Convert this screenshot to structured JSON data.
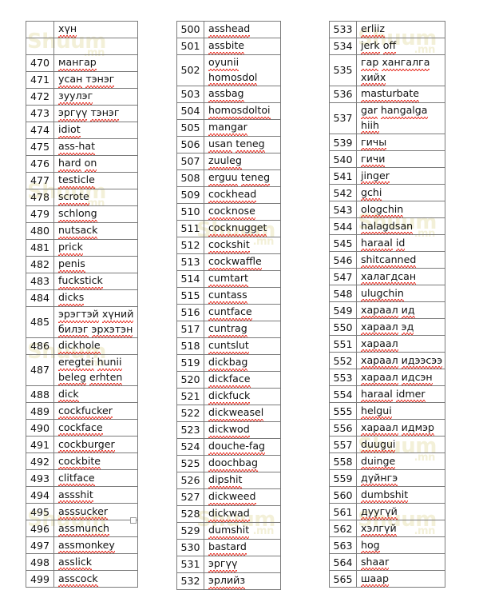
{
  "document": {
    "type": "word-list-table",
    "watermark": {
      "main": "Shuum",
      "sub": ".mn"
    },
    "columns": [
      {
        "id": "column-1",
        "header": {
          "num": "",
          "text": "хүн"
        },
        "rows": [
          {
            "num": "470",
            "text": "мангар"
          },
          {
            "num": "471",
            "text": "усан тэнэг"
          },
          {
            "num": "472",
            "text": "зуулэг"
          },
          {
            "num": "473",
            "text": "эргүү тэнэг"
          },
          {
            "num": "474",
            "text": "idiot"
          },
          {
            "num": "475",
            "text": "ass-hat"
          },
          {
            "num": "476",
            "text": "hard on"
          },
          {
            "num": "477",
            "text": "testicle"
          },
          {
            "num": "478",
            "text": "scrote"
          },
          {
            "num": "479",
            "text": "schlong"
          },
          {
            "num": "480",
            "text": "nutsack"
          },
          {
            "num": "481",
            "text": "prick"
          },
          {
            "num": "482",
            "text": "penis"
          },
          {
            "num": "483",
            "text": "fuckstick"
          },
          {
            "num": "484",
            "text": "dicks"
          },
          {
            "num": "485",
            "text": "эрэгтэй хүний билэг эрхэтэн",
            "lines": [
              "эрэгтэй хүний",
              "билэг эрхэтэн"
            ]
          },
          {
            "num": "486",
            "text": "dickhole"
          },
          {
            "num": "487",
            "text": "eregtei hunii beleg erhten",
            "lines": [
              "eregtei hunii",
              "beleg erhten"
            ]
          },
          {
            "num": "488",
            "text": "dick"
          },
          {
            "num": "489",
            "text": "cockfucker"
          },
          {
            "num": "490",
            "text": "cockface"
          },
          {
            "num": "491",
            "text": "cockburger"
          },
          {
            "num": "492",
            "text": "cockbite"
          },
          {
            "num": "493",
            "text": "clitface"
          },
          {
            "num": "494",
            "text": "assshit"
          },
          {
            "num": "495",
            "text": "asssucker"
          },
          {
            "num": "496",
            "text": "assmunch"
          },
          {
            "num": "497",
            "text": "assmonkey"
          },
          {
            "num": "498",
            "text": "asslick"
          },
          {
            "num": "499",
            "text": "asscock"
          }
        ]
      },
      {
        "id": "column-2",
        "header": null,
        "rows": [
          {
            "num": "500",
            "text": "asshead"
          },
          {
            "num": "501",
            "text": "assbite"
          },
          {
            "num": "502",
            "text": "oyunii homosdol",
            "lines": [
              "oyunii",
              "homosdol"
            ]
          },
          {
            "num": "503",
            "text": "assbag"
          },
          {
            "num": "504",
            "text": "homosdoltoi"
          },
          {
            "num": "505",
            "text": "mangar"
          },
          {
            "num": "506",
            "text": "usan teneg"
          },
          {
            "num": "507",
            "text": "zuuleg"
          },
          {
            "num": "508",
            "text": "erguu teneg"
          },
          {
            "num": "509",
            "text": "cockhead"
          },
          {
            "num": "510",
            "text": "cocknose"
          },
          {
            "num": "511",
            "text": "cocknugget"
          },
          {
            "num": "512",
            "text": "cockshit"
          },
          {
            "num": "513",
            "text": "cockwaffle"
          },
          {
            "num": "514",
            "text": "cumtart"
          },
          {
            "num": "515",
            "text": "cuntass"
          },
          {
            "num": "516",
            "text": "cuntface"
          },
          {
            "num": "517",
            "text": "cuntrag"
          },
          {
            "num": "518",
            "text": "cuntslut"
          },
          {
            "num": "519",
            "text": "dickbag"
          },
          {
            "num": "520",
            "text": "dickface"
          },
          {
            "num": "521",
            "text": "dickfuck"
          },
          {
            "num": "522",
            "text": "dickweasel"
          },
          {
            "num": "523",
            "text": "dickwod"
          },
          {
            "num": "524",
            "text": "douche-fag"
          },
          {
            "num": "525",
            "text": "doochbag"
          },
          {
            "num": "526",
            "text": "dipshit"
          },
          {
            "num": "527",
            "text": "dickweed"
          },
          {
            "num": "528",
            "text": "dickwad"
          },
          {
            "num": "529",
            "text": "dumshit"
          },
          {
            "num": "530",
            "text": "bastard"
          },
          {
            "num": "531",
            "text": "эргүү"
          },
          {
            "num": "532",
            "text": "эрлийз"
          }
        ]
      },
      {
        "id": "column-3",
        "header": null,
        "rows": [
          {
            "num": "533",
            "text": "erliiz"
          },
          {
            "num": "534",
            "text": "jerk off"
          },
          {
            "num": "535",
            "text": "гар хангалга хийх",
            "lines": [
              "гар хангалга",
              "хийх"
            ]
          },
          {
            "num": "536",
            "text": "masturbate"
          },
          {
            "num": "537",
            "text": "gar hangalga hiih",
            "lines": [
              "gar hangalga",
              "hiih"
            ]
          },
          {
            "num": "539",
            "text": "гичы"
          },
          {
            "num": "540",
            "text": "гичи"
          },
          {
            "num": "541",
            "text": "jinger"
          },
          {
            "num": "542",
            "text": "gchi"
          },
          {
            "num": "543",
            "text": "ologchin"
          },
          {
            "num": "544",
            "text": "halagdsan"
          },
          {
            "num": "545",
            "text": "haraal id"
          },
          {
            "num": "546",
            "text": "shitcanned"
          },
          {
            "num": "547",
            "text": "халагдсан"
          },
          {
            "num": "548",
            "text": "ulugchin"
          },
          {
            "num": "549",
            "text": "хараал ид"
          },
          {
            "num": "550",
            "text": "хараал эд"
          },
          {
            "num": "551",
            "text": "хараал"
          },
          {
            "num": "552",
            "text": "хараал идээсээ"
          },
          {
            "num": "553",
            "text": "хараал идсэн"
          },
          {
            "num": "554",
            "text": "haraal idmer"
          },
          {
            "num": "555",
            "text": "helgui"
          },
          {
            "num": "556",
            "text": "хараал идмэр"
          },
          {
            "num": "557",
            "text": "duugui"
          },
          {
            "num": "558",
            "text": "duinge"
          },
          {
            "num": "559",
            "text": "дүйнгэ"
          },
          {
            "num": "560",
            "text": "dumbshit"
          },
          {
            "num": "561",
            "text": "дуугүй"
          },
          {
            "num": "562",
            "text": "хэлгүй"
          },
          {
            "num": "563",
            "text": "hog"
          },
          {
            "num": "564",
            "text": "shaar"
          },
          {
            "num": "565",
            "text": "шаар"
          }
        ]
      }
    ]
  },
  "colors": {
    "border": "#7b7b7b",
    "text": "#111111",
    "spellcheck_underline": "#e8352a",
    "watermark": "#f3f0d8",
    "background": "#ffffff"
  }
}
